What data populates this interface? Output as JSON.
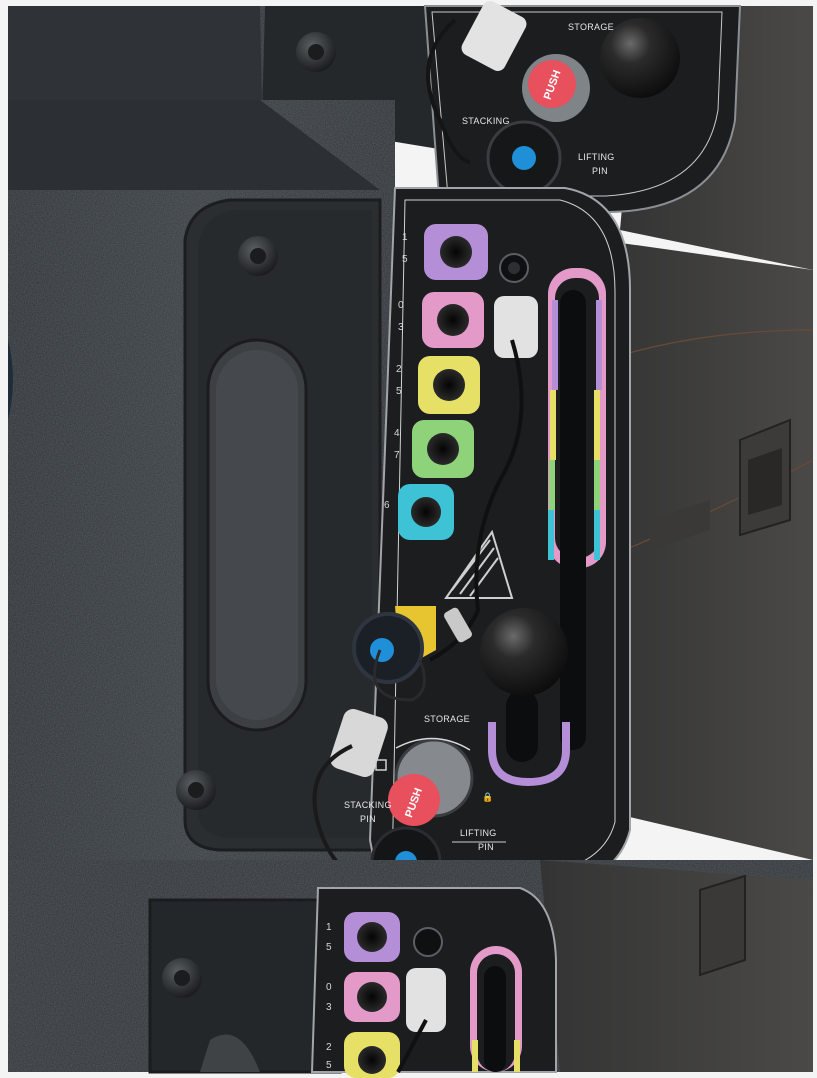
{
  "top_plate": {
    "storage_label": "STORAGE",
    "stacking_label": "STACKING",
    "lifting_label": "LIFTING",
    "pin_label": "PIN",
    "push_label": "PUSH"
  },
  "middle_plate": {
    "holes": [
      {
        "label_a": "1",
        "label_b": "5",
        "color": "#b48fd8"
      },
      {
        "label_a": "0",
        "label_b": "3",
        "color": "#e39ac8"
      },
      {
        "label_a": "2",
        "label_b": "5",
        "color": "#e6e066"
      },
      {
        "label_a": "4",
        "label_b": "7",
        "color": "#8ed37a"
      },
      {
        "label_a": "6",
        "label_b": "",
        "color": "#3ec2d6"
      }
    ],
    "storage_label": "STORAGE",
    "stacking_label": "STACKING",
    "stacking_pin_label": "PIN",
    "lifting_label": "LIFTING",
    "pin_label": "PIN",
    "push_label": "PUSH"
  },
  "bottom_plate": {
    "holes": [
      {
        "label_a": "1",
        "label_b": "5",
        "color": "#b48fd8"
      },
      {
        "label_a": "0",
        "label_b": "3",
        "color": "#e39ac8"
      },
      {
        "label_a": "2",
        "label_b": "5",
        "color": "#e6e066"
      }
    ]
  },
  "colors": {
    "cabinet": "#2b2f33",
    "plate": "#1b1d1f",
    "pin_button": "#1f8fd8",
    "push_button": "#e8505e",
    "lavender": "#b48fd8",
    "pink": "#e39ac8",
    "yellow": "#e6e066",
    "green": "#8ed37a",
    "cyan": "#3ec2d6"
  }
}
